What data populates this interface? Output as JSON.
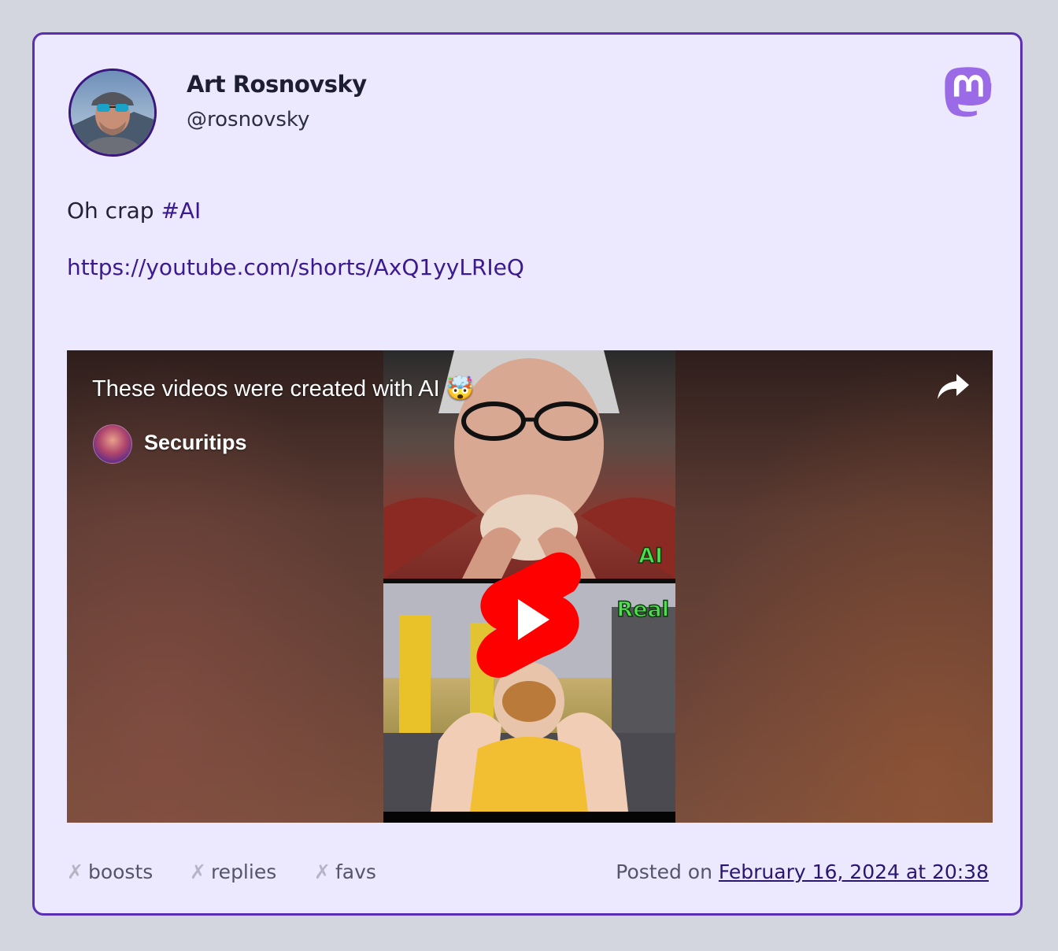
{
  "author": {
    "name": "Art Rosnovsky",
    "handle": "@rosnovsky",
    "avatar_icon": "user-avatar-photo"
  },
  "platform_icon": "mastodon-logo-icon",
  "post": {
    "text": "Oh crap ",
    "hashtag": "#AI",
    "link": "https://youtube.com/shorts/AxQ1yyLRIeQ"
  },
  "embed": {
    "video_title": "These videos were created with AI 🤯",
    "channel_name": "Securitips",
    "label_top": "AI",
    "label_bottom": "Real",
    "share_icon": "share-arrow-icon",
    "play_icon": "youtube-shorts-play-icon"
  },
  "footer": {
    "boosts_label": "boosts",
    "replies_label": "replies",
    "favs_label": "favs",
    "stat_mark": "✗",
    "posted_prefix": "Posted on ",
    "posted_date": "February 16, 2024 at 20:38"
  },
  "colors": {
    "page_background": "#d3d6de",
    "card_background": "#ece8fd",
    "card_border": "#5a2fb3",
    "link": "#3b1a8f",
    "mastodon_purple": "#9b6ae6",
    "shorts_red": "#ff0000"
  }
}
